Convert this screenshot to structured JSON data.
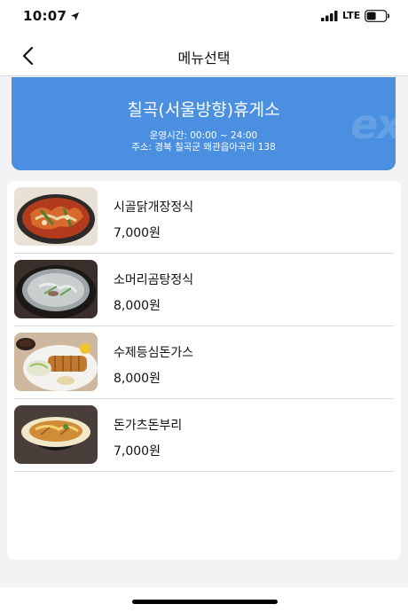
{
  "status_bar": {
    "time": "10:07",
    "network": "LTE"
  },
  "nav": {
    "title": "메뉴선택"
  },
  "rest_area": {
    "name": "칠곡(서울방향)휴게소",
    "hours": "운영시간: 00:00 ~ 24:00",
    "address": "주소: 경북 칠곡군 왜관읍아곡리 138"
  },
  "menu_items": [
    {
      "name": "시골닭개장정식",
      "price": "7,000원"
    },
    {
      "name": "소머리곰탕정식",
      "price": "8,000원"
    },
    {
      "name": "수제등심돈가스",
      "price": "8,000원"
    },
    {
      "name": "돈가츠돈부리",
      "price": "7,000원"
    }
  ],
  "colors": {
    "banner": "#4a8fe0",
    "background": "#f2f2f4"
  },
  "icons": [
    "location-arrow-icon",
    "signal-icon",
    "battery-icon",
    "back-chevron-icon"
  ]
}
